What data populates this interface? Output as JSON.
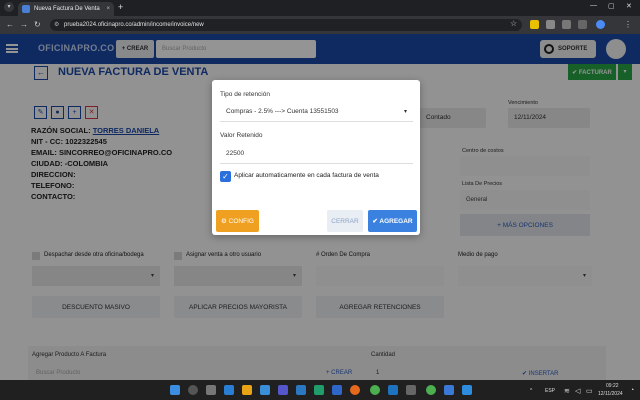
{
  "browser": {
    "tab_title": "Nueva Factura De Venta",
    "url": "prueba2024.oficinapro.co/admin/income/invoice/new",
    "new_tab": "+",
    "tab_close": "×"
  },
  "header": {
    "brand": "OFICINAPRO.CO",
    "crear_label": "+ CREAR",
    "search_placeholder": "Buscar Producto",
    "soporte_label": "SOPORTE"
  },
  "page": {
    "title": "NUEVA FACTURA DE VENTA",
    "facturar_label": "✔ FACTURAR",
    "client": {
      "razon_label": "RAZÓN SOCIAL:",
      "razon_value": "TORRES DANIELA",
      "nit_label": "NIT - CC:",
      "nit_value": "1022322545",
      "email_label": "EMAIL:",
      "email_value": "SINCORREO@OFICINAPRO.CO",
      "ciudad_label": "CIUDAD:",
      "ciudad_value": "-COLOMBIA",
      "direccion_label": "DIRECCION:",
      "telefono_label": "TELEFONO:",
      "contacto_label": "CONTACTO:"
    },
    "forma_pago_value": "Contado",
    "vencimiento_label": "Vencimiento",
    "vencimiento_value": "12/11/2024",
    "centro_costos_label": "Centro de costos",
    "lista_precios_label": "Lista De Precios",
    "lista_precios_value": "General",
    "mas_opciones_label": "+ MÁS OPCIONES",
    "despachar_label": "Despachar desde otra oficina/bodega",
    "asignar_label": "Asignar venta a otro usuario",
    "orden_compra_label": "# Orden De Compra",
    "medio_pago_label": "Medio de pago",
    "descuento_label": "DESCUENTO MASIVO",
    "mayorista_label": "APLICAR PRECIOS MAYORISTA",
    "retenciones_label": "AGREGAR RETENCIONES",
    "agregar_producto_label": "Agregar Producto A Factura",
    "buscar_producto_placeholder": "Buscar Producto",
    "crear_producto_label": "+ CREAR",
    "cantidad_label": "Cantidad",
    "cantidad_value": "1",
    "insertar_label": "✔ INSERTAR"
  },
  "modal": {
    "tipo_label": "Tipo de retención",
    "tipo_value": "Compras - 2.5% ---> Cuenta 13551503",
    "valor_label": "Valor Retenido",
    "valor_value": "22500",
    "apply_label": "Aplicar automaticamente en cada factura de venta",
    "config_label": "⚙ CONFIG",
    "cerrar_label": "CERRAR",
    "agregar_label": "✔ AGREGAR"
  },
  "taskbar": {
    "lang": "ESP",
    "time": "09:22",
    "date": "12/11/2024"
  }
}
